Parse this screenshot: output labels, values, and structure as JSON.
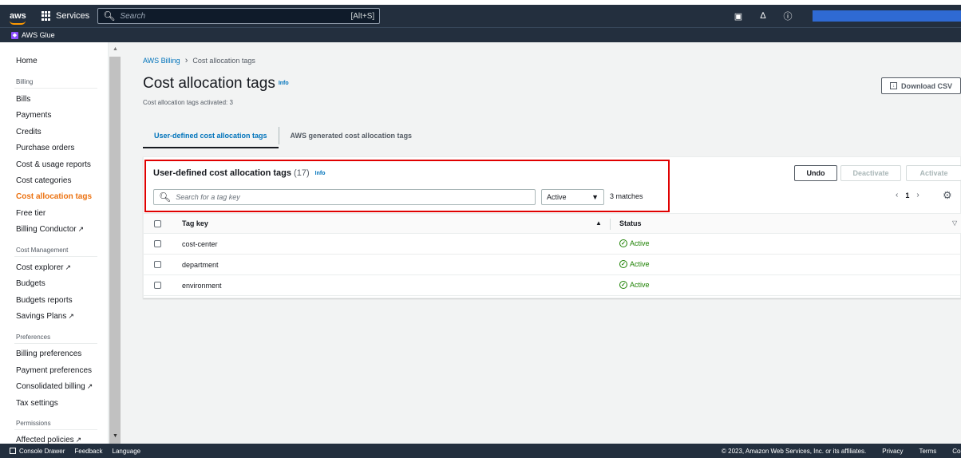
{
  "topnav": {
    "logo": "aws",
    "services_label": "Services",
    "search_placeholder": "Search",
    "search_shortcut": "[Alt+S]"
  },
  "subnav": {
    "service_label": "AWS Glue"
  },
  "sidebar": {
    "home": "Home",
    "billing_head": "Billing",
    "billing_items": [
      "Bills",
      "Payments",
      "Credits",
      "Purchase orders",
      "Cost & usage reports",
      "Cost categories",
      "Cost allocation tags",
      "Free tier",
      "Billing Conductor"
    ],
    "cost_mgmt_head": "Cost Management",
    "cost_mgmt_items": [
      "Cost explorer",
      "Budgets",
      "Budgets reports",
      "Savings Plans"
    ],
    "preferences_head": "Preferences",
    "preferences_items": [
      "Billing preferences",
      "Payment preferences",
      "Consolidated billing",
      "Tax settings"
    ],
    "permissions_head": "Permissions",
    "permissions_items": [
      "Affected policies"
    ]
  },
  "main": {
    "breadcrumb": {
      "parent": "AWS Billing",
      "current": "Cost allocation tags"
    },
    "title": "Cost allocation tags",
    "info": "Info",
    "subtitle": "Cost allocation tags activated: 3",
    "download_label": "Download CSV",
    "tabs": [
      "User-defined cost allocation tags",
      "AWS generated cost allocation tags"
    ],
    "panel": {
      "title": "User-defined cost allocation tags",
      "count": "(17)",
      "info": "Info",
      "filter_placeholder": "Search for a tag key",
      "status_select": "Active",
      "matches": "3 matches",
      "undo": "Undo",
      "deactivate": "Deactivate",
      "activate": "Activate",
      "page": "1",
      "columns": {
        "key": "Tag key",
        "status": "Status"
      },
      "rows": [
        {
          "key": "cost-center",
          "status": "Active"
        },
        {
          "key": "department",
          "status": "Active"
        },
        {
          "key": "environment",
          "status": "Active"
        }
      ]
    }
  },
  "footer": {
    "console_drawer": "Console Drawer",
    "feedback": "Feedback",
    "language": "Language",
    "copyright": "© 2023, Amazon Web Services, Inc. or its affiliates.",
    "privacy": "Privacy",
    "terms": "Terms",
    "cookie": "Cookie preferences"
  },
  "colors": {
    "accent": "#0073bb",
    "active_nav": "#ec7211",
    "status_ok": "#1d8102",
    "highlight": "#e00000",
    "topnav": "#232f3e"
  }
}
